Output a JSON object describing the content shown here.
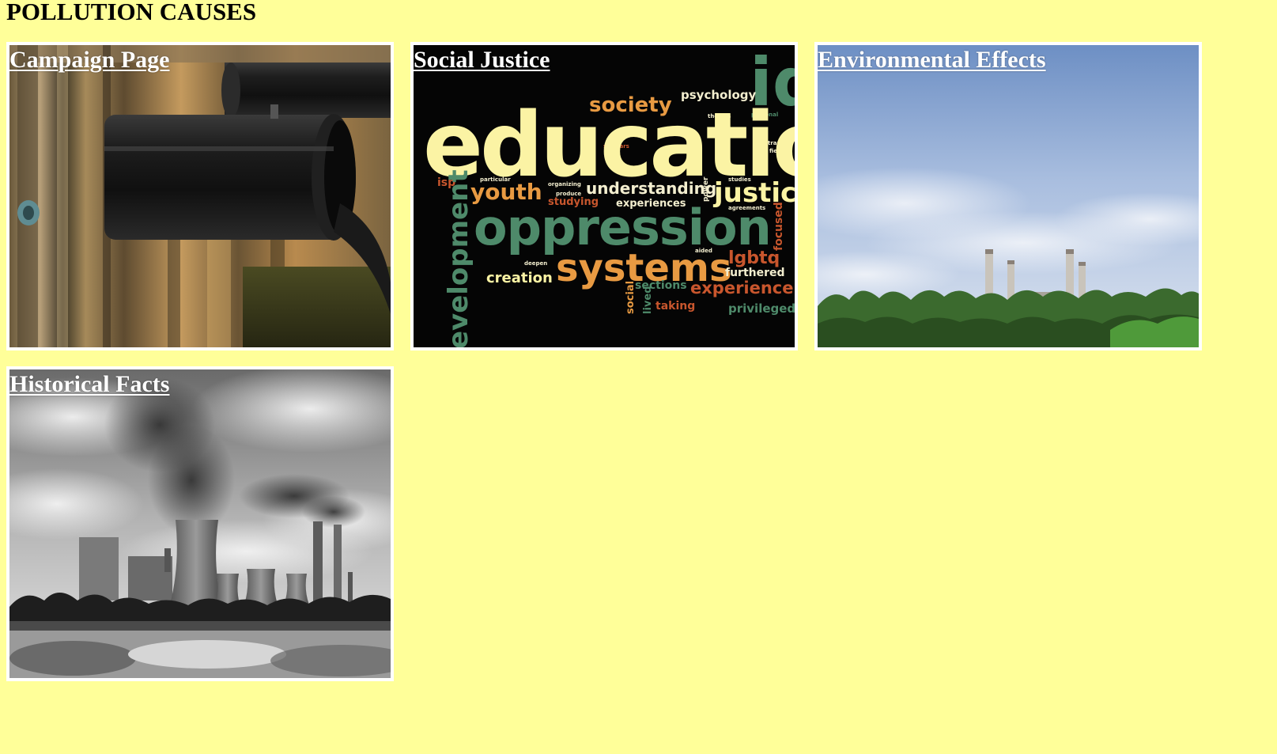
{
  "page": {
    "title": "POLLUTION CAUSES",
    "background_color": "#ffff99"
  },
  "tiles": [
    {
      "label": "Campaign Page",
      "image_icon": "pipes-photo"
    },
    {
      "label": "Social Justice",
      "image_icon": "word-cloud-image"
    },
    {
      "label": "Environmental Effects",
      "image_icon": "factory-skyline-photo"
    },
    {
      "label": "Historical Facts",
      "image_icon": "power-plant-photo"
    }
  ],
  "word_cloud": {
    "education": "educatio",
    "id": "id",
    "society": "society",
    "psychology": "psychology",
    "youth": "youth",
    "understanding": "understanding",
    "justice": "justic",
    "oppression": "oppression",
    "development": "evelopment",
    "systems": "systems",
    "lgbtq": "lgbtq",
    "creation": "creation",
    "experience": "experience",
    "furthered": "furthered",
    "sections": "sections",
    "privileged": "privileged",
    "taking": "taking",
    "social": "social",
    "lived": "lived",
    "focused": "focused",
    "studying": "studying",
    "experiences": "experiences",
    "isp": "isp",
    "themes": "themes",
    "personal": "personal",
    "agreements": "agreements",
    "aided": "aided",
    "deepen": "deepen",
    "particular": "particular",
    "organizing": "organizing",
    "produce": "produce",
    "trans": "trans",
    "field": "field",
    "scholars": "scholars",
    "power": "power",
    "studies": "studies"
  },
  "colors": {
    "tile_border": "#ffffff",
    "link_text": "#ffffff",
    "wc_cream": "#fbf3a4",
    "wc_green": "#4e8a6a",
    "wc_orange": "#e89a42",
    "wc_red": "#c8562d"
  }
}
